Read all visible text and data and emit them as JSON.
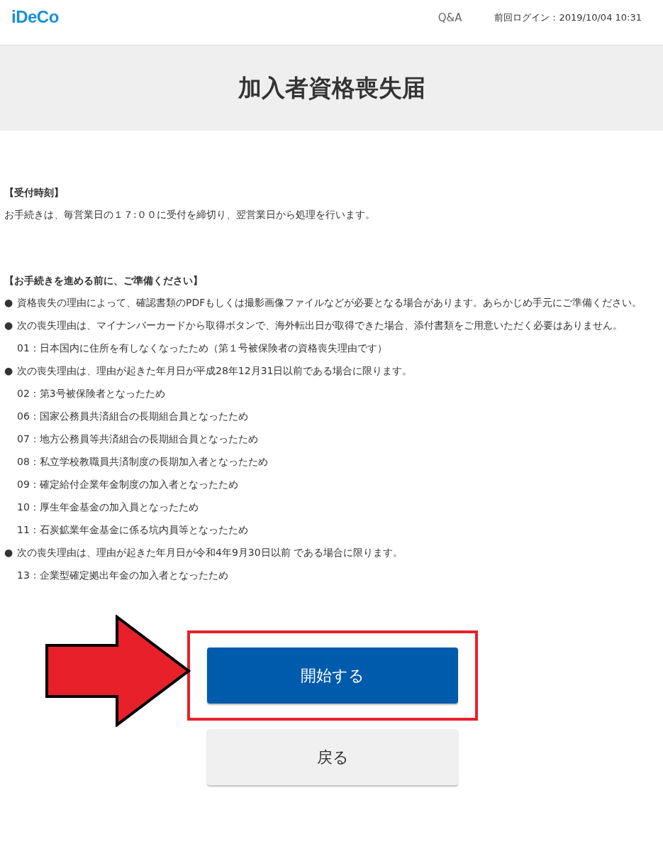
{
  "header": {
    "logo": "iDeCo",
    "links": [
      {
        "label": "Q&A"
      }
    ],
    "last_login": "前回ログイン：2019/10/04 10:31"
  },
  "page_title": "加入者資格喪失届",
  "sections": [
    {
      "heading": "【受付時刻】",
      "items": [
        {
          "kind": "text",
          "text": "お手続きは、毎営業日の１７:００に受付を締切り、翌営業日から処理を行います。"
        }
      ]
    },
    {
      "heading": "【お手続きを進める前に、ご準備ください】",
      "items": [
        {
          "kind": "bullet",
          "marker": "●",
          "text": "資格喪失の理由によって、確認書類のPDFもしくは撮影画像ファイルなどが必要となる場合があります。あらかじめ手元にご準備ください。"
        },
        {
          "kind": "bullet",
          "marker": "●",
          "text": "次の喪失理由は、マイナンバーカードから取得ボタンで、海外転出日が取得できた場合、添付書類をご用意いただく必要はありません。"
        },
        {
          "kind": "sub",
          "text": "01：日本国内に住所を有しなくなったため（第１号被保険者の資格喪失理由です）"
        },
        {
          "kind": "bullet",
          "marker": "●",
          "text": "次の喪失理由は、理由が起きた年月日が平成28年12月31日以前である場合に限ります。"
        },
        {
          "kind": "sub",
          "text": "02：第3号被保険者となったため"
        },
        {
          "kind": "sub",
          "text": "06：国家公務員共済組合の長期組合員となったため"
        },
        {
          "kind": "sub",
          "text": "07：地方公務員等共済組合の長期組合員となったため"
        },
        {
          "kind": "sub",
          "text": "08：私立学校教職員共済制度の長期加入者となったため"
        },
        {
          "kind": "sub",
          "text": "09：確定給付企業年金制度の加入者となったため"
        },
        {
          "kind": "sub",
          "text": "10：厚生年金基金の加入員となったため"
        },
        {
          "kind": "sub",
          "text": "11：石炭鉱業年金基金に係る坑内員等となったため"
        },
        {
          "kind": "bullet",
          "marker": "●",
          "text": "次の喪失理由は、理由が起きた年月日が令和4年9月30日以前 である場合に限ります。"
        },
        {
          "kind": "sub",
          "text": "13：企業型確定拠出年金の加入者となったため"
        }
      ]
    }
  ],
  "buttons": [
    {
      "label": "開始する",
      "kind": "primary",
      "highlighted": true
    },
    {
      "label": "戻る",
      "kind": "secondary",
      "highlighted": false
    }
  ]
}
